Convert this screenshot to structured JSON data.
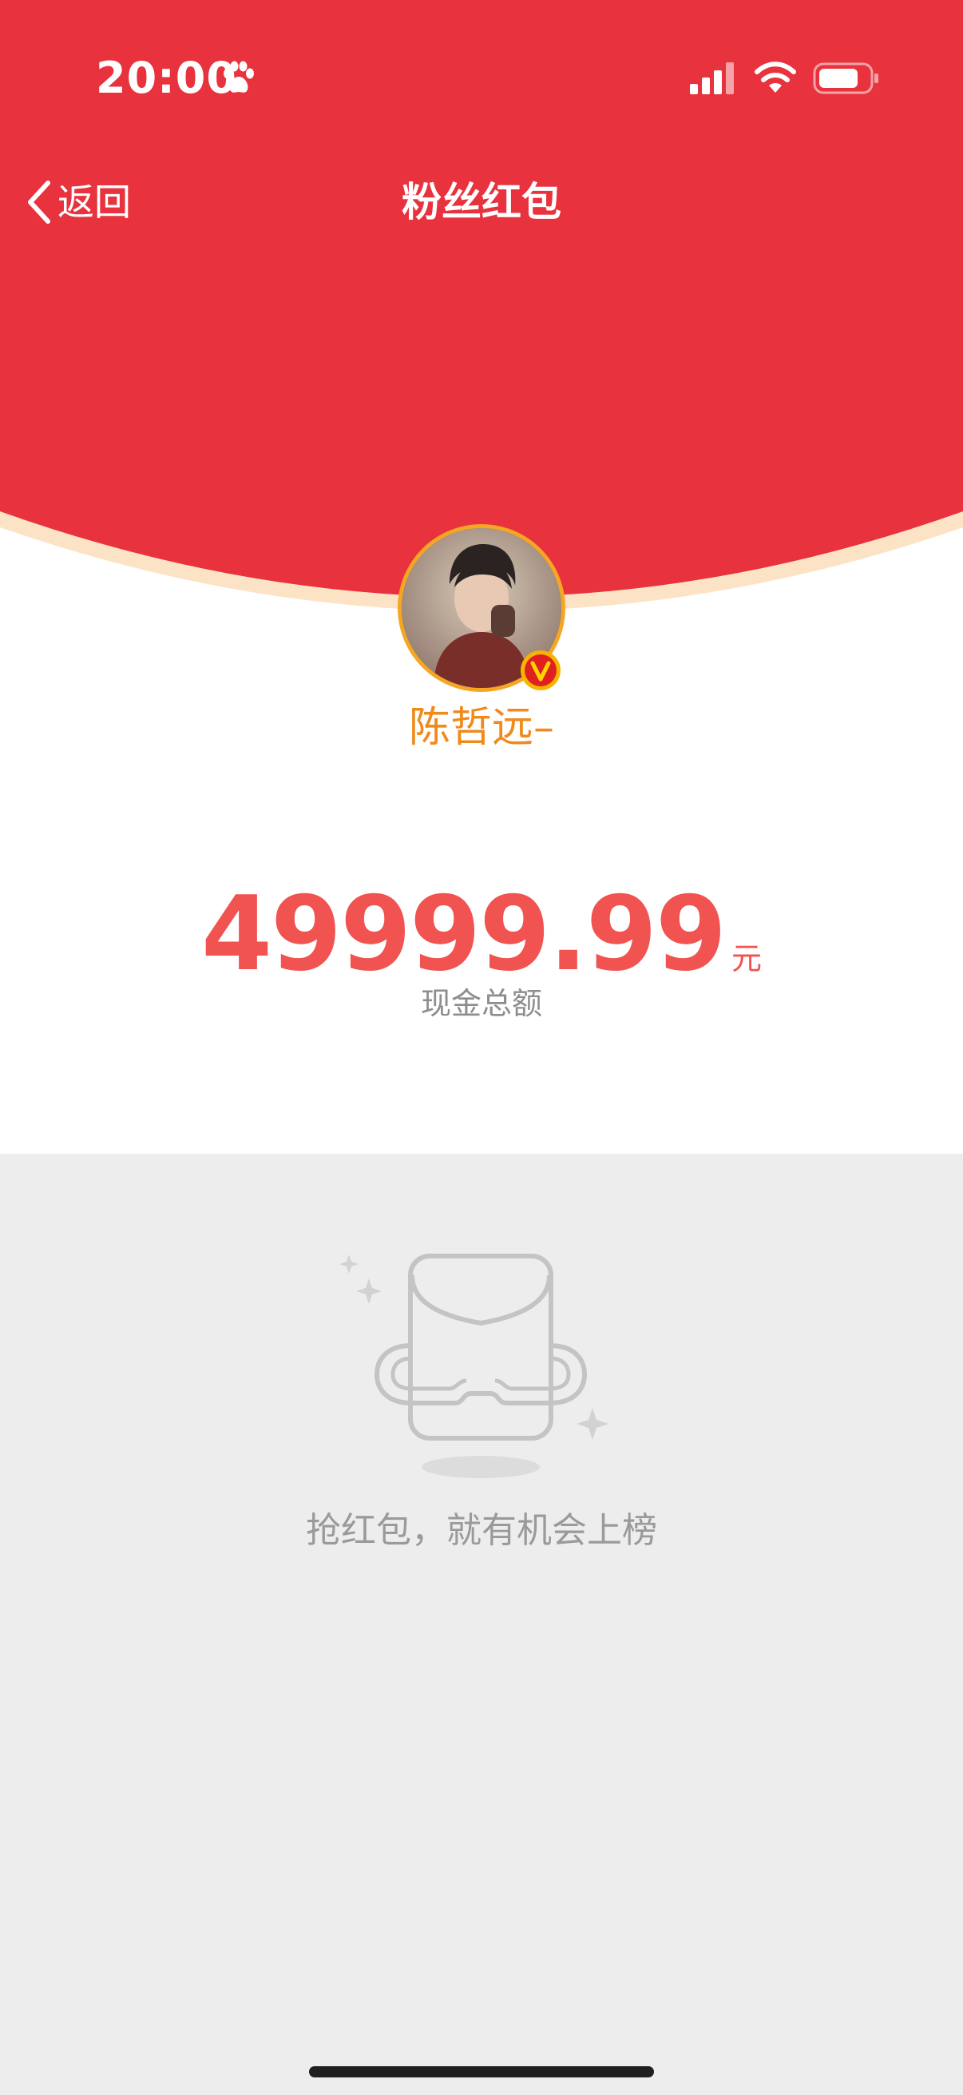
{
  "status_bar": {
    "time": "20:00",
    "icons": [
      "paw-icon",
      "signal-icon",
      "wifi-icon",
      "battery-icon"
    ]
  },
  "nav": {
    "back_label": "返回",
    "title": "粉丝红包"
  },
  "profile": {
    "username": "陈哲远–",
    "verified_badge_letter": "V"
  },
  "amount": {
    "value": "49999.99",
    "unit": "元",
    "caption": "现金总额"
  },
  "empty_state": {
    "message": "抢红包，就有机会上榜"
  },
  "colors": {
    "header_red": "#e8323d",
    "arc_shadow": "#fde3c6",
    "username": "#f08a1c",
    "amount": "#f05350",
    "page_bg": "#ededed",
    "avatar_ring": "#f5a623"
  }
}
